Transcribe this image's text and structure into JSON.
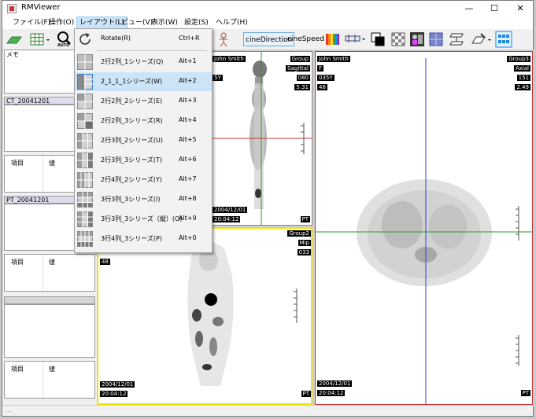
{
  "window": {
    "title": "RMViewer",
    "controls": [
      "—",
      "☐",
      "✕"
    ]
  },
  "menubar": {
    "items": [
      {
        "label": "ファイル(F)"
      },
      {
        "label": "操作(O)"
      },
      {
        "label": "レイアウト(L)"
      },
      {
        "label": "ビュー(V)"
      },
      {
        "label": "表示(W)"
      },
      {
        "label": "設定(S)"
      },
      {
        "label": "ヘルプ(H)"
      }
    ]
  },
  "toolbar": {
    "cine_direction": "cineDirection",
    "cine_speed": "cineSpeed",
    "auto_label": "AUTO"
  },
  "layout_menu": {
    "rotate": {
      "label": "Rotate(R)",
      "shortcut": "Ctrl+R"
    },
    "items": [
      {
        "label": "2行2列_1シリーズ(Q)",
        "shortcut": "Alt+1"
      },
      {
        "label": "2_1_1_1シリーズ(W)",
        "shortcut": "Alt+2"
      },
      {
        "label": "2行2列_2シリーズ(E)",
        "shortcut": "Alt+3"
      },
      {
        "label": "2行2列_3シリーズ(R)",
        "shortcut": "Alt+4"
      },
      {
        "label": "2行3列_2シリーズ(U)",
        "shortcut": "Alt+5"
      },
      {
        "label": "2行3列_3シリーズ(T)",
        "shortcut": "Alt+6"
      },
      {
        "label": "2行4列_2シリーズ(Y)",
        "shortcut": "Alt+7"
      },
      {
        "label": "3行3列_3シリーズ(I)",
        "shortcut": "Alt+8"
      },
      {
        "label": "3行3列_3シリーズ（縦）(O)",
        "shortcut": "Alt+9"
      },
      {
        "label": "3行4列_3シリーズ(P)",
        "shortcut": "Alt+0"
      }
    ]
  },
  "left_panel": {
    "memo_label": "メモ",
    "series": [
      {
        "header": "CT_20041201",
        "col_item": "項目",
        "col_value": "値"
      },
      {
        "header": "PT_20041201",
        "col_item": "項目",
        "col_value": "値"
      },
      {
        "header": "",
        "col_item": "項目",
        "col_value": "値"
      }
    ]
  },
  "viewports": {
    "top_left": {
      "patient": "John Smith",
      "group": "Group",
      "plane": "Sagittal",
      "info1": "5Y",
      "n1": "080",
      "n2": "5.31",
      "date": "2004/12/01",
      "time": "20:04:12",
      "modality": "PT"
    },
    "bottom_left": {
      "group": "Group2",
      "plane": "Mip",
      "n1": "033",
      "n2": "48",
      "date": "2004/12/01",
      "time": "20:04:12",
      "modality": "PT"
    },
    "right": {
      "patient": "John Smith",
      "sex": "F",
      "age": "035Y",
      "n2": "48",
      "group": "Group3",
      "plane": "Axial",
      "n1": "151",
      "n3": "2.49",
      "date": "2004/12/01",
      "time": "20:04:12",
      "modality": "PT"
    }
  },
  "colors": {
    "active_menu": "#cce4f7",
    "selected_viewport": "#f0e600",
    "right_viewport_border": "#cc3333",
    "crosshair_v": "#2e44d8",
    "crosshair_h": "#2a9a2a"
  }
}
